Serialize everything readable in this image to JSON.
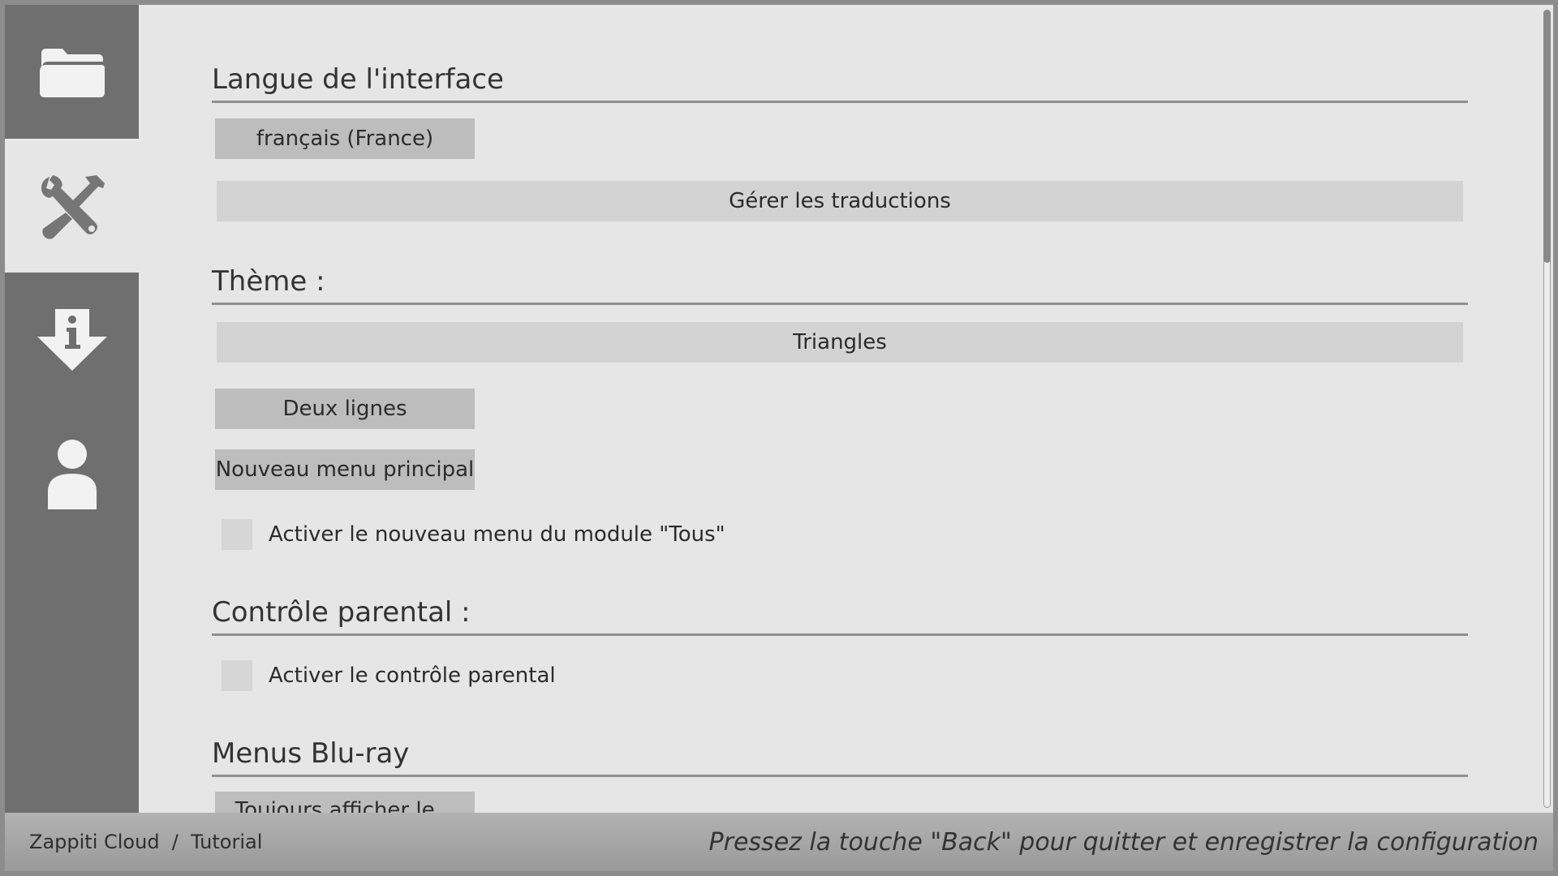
{
  "sidebar": {
    "items": [
      {
        "icon": "folder-icon",
        "active": false
      },
      {
        "icon": "tools-icon",
        "active": true
      },
      {
        "icon": "info-download-icon",
        "active": false
      },
      {
        "icon": "user-icon",
        "active": false
      }
    ]
  },
  "sections": {
    "language": {
      "title": "Langue de l'interface",
      "language_value": "français (France)",
      "manage_translations": "Gérer les traductions"
    },
    "theme": {
      "title": "Thème :",
      "theme_value": "Triangles",
      "layout_value": "Deux lignes",
      "menu_value": "Nouveau menu principal",
      "checkbox_label": "Activer le nouveau menu du module \"Tous\"",
      "checkbox_checked": false
    },
    "parental": {
      "title": "Contrôle parental :",
      "checkbox_label": "Activer le contrôle parental",
      "checkbox_checked": false
    },
    "bluray": {
      "title": "Menus Blu-ray",
      "option_value": "Toujours afficher le..."
    }
  },
  "scroll": {
    "position": 0.0
  },
  "footer": {
    "breadcrumb": "Zappiti Cloud  /  Tutorial",
    "hint": "Pressez la touche \"Back\" pour quitter et enregistrer la configuration"
  },
  "colors": {
    "sidebar": "#6f6f6f",
    "content": "#e6e6e6",
    "button": "#bdbdbd",
    "button_wide": "#d3d3d3"
  }
}
